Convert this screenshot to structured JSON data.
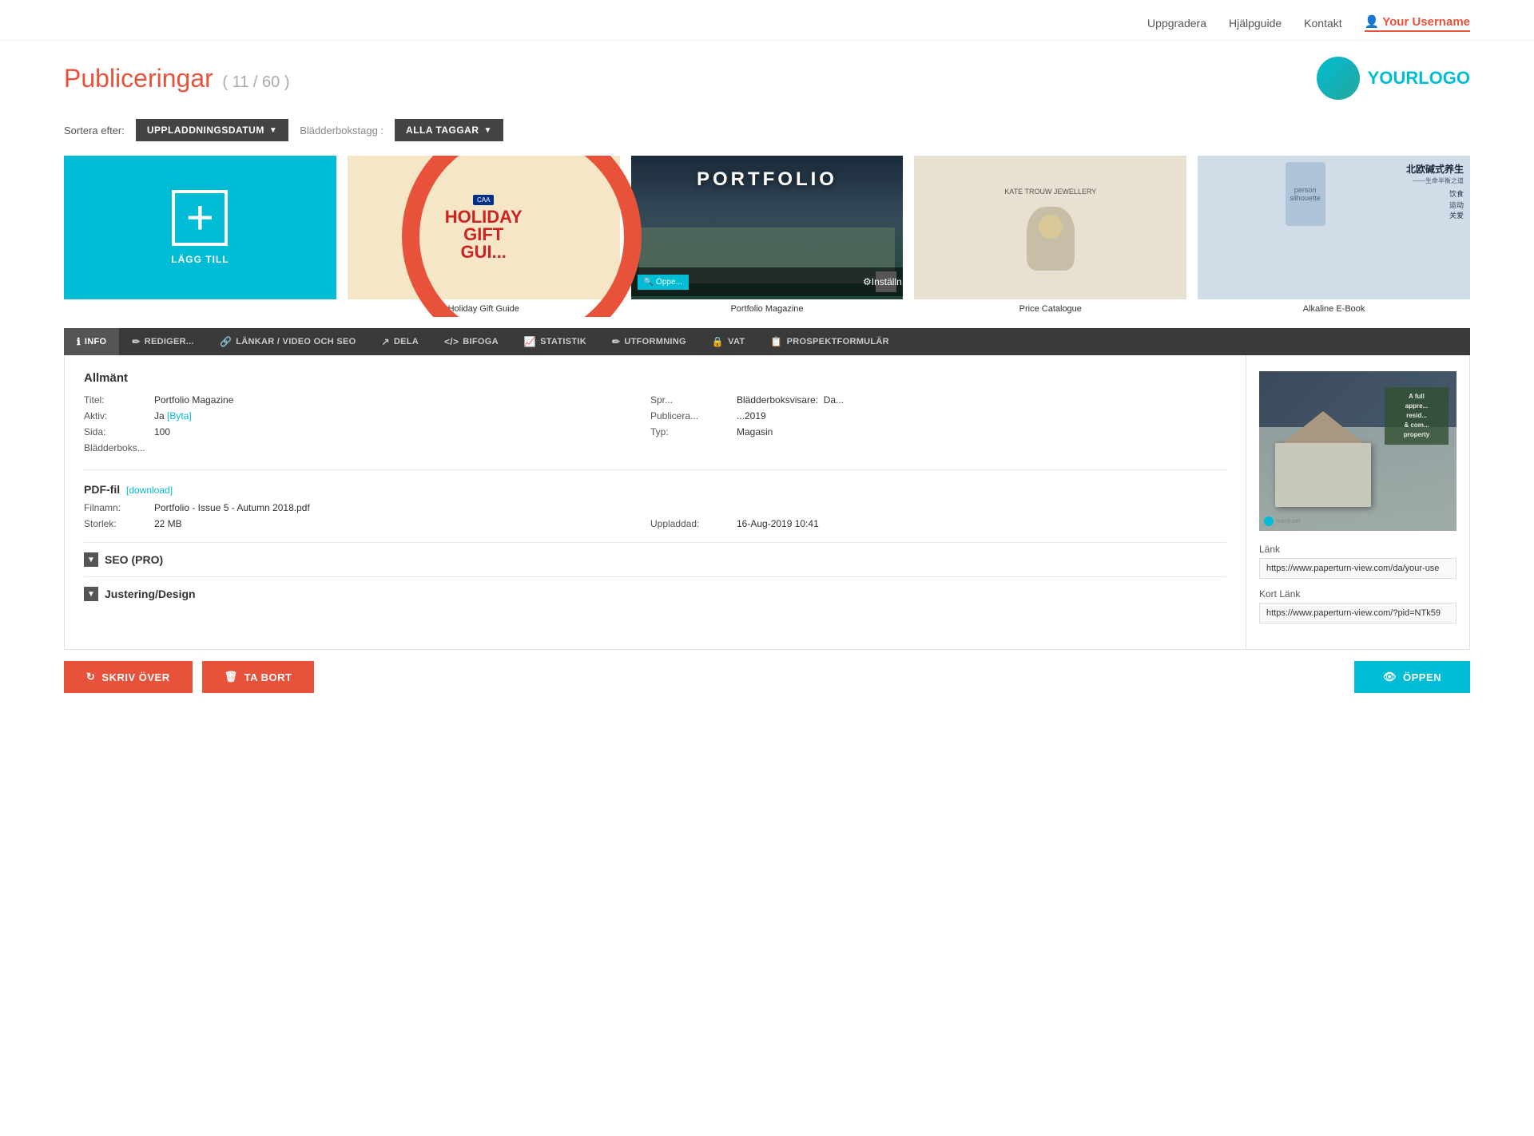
{
  "nav": {
    "upgrade_label": "Uppgradera",
    "help_label": "Hjälpguide",
    "contact_label": "Kontakt",
    "username_label": "Your Username",
    "username_icon": "👤"
  },
  "header": {
    "title": "Publiceringar",
    "count": "( 11 / 60 )",
    "logo_text_main": "YOUR",
    "logo_text_accent": "LOGO"
  },
  "filters": {
    "sort_label": "Sortera efter:",
    "sort_value": "UPPLADDNINGSDATUM",
    "tag_label": "Blädderbokstagg :",
    "tag_value": "ALLA TAGGAR"
  },
  "books": [
    {
      "id": "add",
      "type": "add",
      "label": "LÄGG TILL"
    },
    {
      "id": "holiday",
      "type": "book",
      "title": "Holiday Gift Guide",
      "thumb_type": "holiday"
    },
    {
      "id": "portfolio",
      "type": "book",
      "title": "Portfolio Magazine",
      "thumb_type": "portfolio",
      "selected": true
    },
    {
      "id": "price",
      "type": "book",
      "title": "Price Catalogue",
      "thumb_type": "price"
    },
    {
      "id": "alkaline",
      "type": "book",
      "title": "Alkaline E-Book",
      "thumb_type": "alkaline"
    }
  ],
  "tabs": [
    {
      "id": "info",
      "label": "INFO",
      "icon": "ℹ",
      "active": true
    },
    {
      "id": "edit",
      "label": "REDIGER...",
      "icon": "✏"
    },
    {
      "id": "links",
      "label": "LÄNKAR / VIDEO OCH SEO",
      "icon": "🔗",
      "active": true
    },
    {
      "id": "share",
      "label": "DELA",
      "icon": "↗"
    },
    {
      "id": "embed",
      "label": "BIFOGA",
      "icon": "</>"
    },
    {
      "id": "stats",
      "label": "STATISTIK",
      "icon": "📈"
    },
    {
      "id": "design",
      "label": "UTFORMNING",
      "icon": "✏"
    },
    {
      "id": "vat",
      "label": "VAT",
      "icon": "🔒"
    },
    {
      "id": "prospect",
      "label": "PROSPEKTFORMULÄR",
      "icon": "📋"
    }
  ],
  "info_section": {
    "general_title": "Allmänt",
    "title_label": "Titel:",
    "title_value": "Portfolio Magazine",
    "active_label": "Aktiv:",
    "active_value": "Ja",
    "active_link": "[Byta]",
    "lang_label": "Spr...",
    "lang_value": "bladder...",
    "lang_sub": "Da...",
    "pages_label": "Sida:",
    "pages_value": "100",
    "published_label": "Publica...",
    "published_value": "...2019",
    "type_label": "Typ:",
    "type_value": "Magasin",
    "tag_label": "Blädderboks...",
    "tag_value": ""
  },
  "pdf_section": {
    "title": "PDF-fil",
    "download_link": "[download]",
    "filename_label": "Filnamn:",
    "filename_value": "Portfolio - Issue 5 - Autumn 2018.pdf",
    "size_label": "Storlek:",
    "size_value": "22 MB",
    "upload_label": "Uppladdad:",
    "upload_value": "16-Aug-2019 10:41"
  },
  "seo_section": {
    "label": "SEO (PRO)"
  },
  "design_section": {
    "label": "Justering/Design"
  },
  "links_section": {
    "link_label": "Länk",
    "link_value": "https://www.paperturn-view.com/da/your-use",
    "short_link_label": "Kort Länk",
    "short_link_value": "https://www.paperturn-view.com/?pid=NTk59"
  },
  "action_buttons": {
    "overwrite_label": "SKRIV ÖVER",
    "delete_label": "TA BORT",
    "open_label": "ÖPPEN",
    "overwrite_icon": "↻",
    "delete_icon": "🗑",
    "open_icon": "👁"
  },
  "book_preview": {
    "text": "A full\nappre...\nresid...\n& com...\nproperty"
  }
}
